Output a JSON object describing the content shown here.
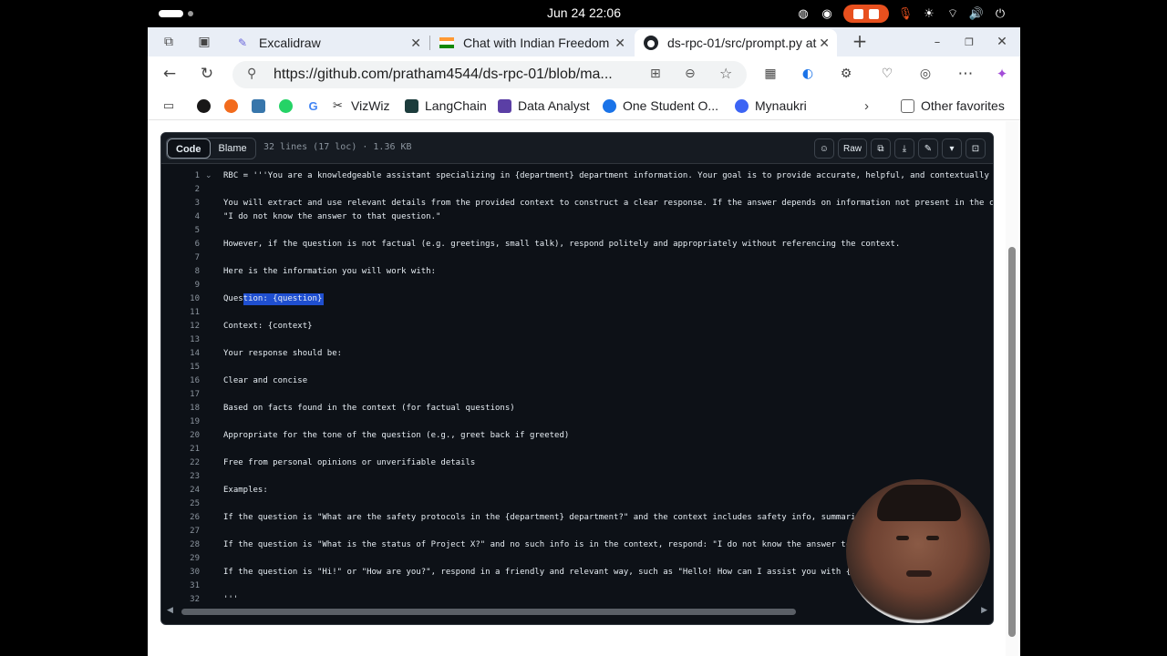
{
  "system": {
    "clock": "Jun 24  22:06"
  },
  "tabs": [
    {
      "label": "Excalidraw",
      "icon": "excalidraw-icon"
    },
    {
      "label": "Chat with Indian Freedom",
      "icon": "india-flag-icon"
    },
    {
      "label": "ds-rpc-01/src/prompt.py at",
      "icon": "github-icon",
      "active": true
    }
  ],
  "nav": {
    "url": "https://github.com/pratham4544/ds-rpc-01/blob/ma..."
  },
  "bookmarks": [
    {
      "label": "",
      "icon": "github-icon",
      "color": "#181717"
    },
    {
      "label": "",
      "icon": "orange-circle-icon",
      "color": "#f26b1d"
    },
    {
      "label": "",
      "icon": "python-icon",
      "color": "#3776ab"
    },
    {
      "label": "",
      "icon": "whatsapp-icon",
      "color": "#25d366"
    },
    {
      "label": "",
      "icon": "google-icon",
      "color": "#4285f4"
    },
    {
      "label": "VizWiz",
      "icon": "vizwiz-icon",
      "color": "#333333"
    },
    {
      "label": "LangChain",
      "icon": "langchain-icon",
      "color": "#1c3c3c"
    },
    {
      "label": "Data Analyst",
      "icon": "data-analyst-icon",
      "color": "#5b3fa5"
    },
    {
      "label": "One Student O...",
      "icon": "one-student-icon",
      "color": "#1a73e8"
    },
    {
      "label": "Mynaukri",
      "icon": "mynaukri-icon",
      "color": "#3c64f4"
    }
  ],
  "bookmarks_other": "Other favorites",
  "code": {
    "tab_code": "Code",
    "tab_blame": "Blame",
    "meta": "32 lines (17 loc) · 1.36 KB",
    "raw_label": "Raw",
    "lines": [
      {
        "n": "1",
        "t": "RBC = '''You are a knowledgeable assistant specializing in {department} department information. Your goal is to provide accurate, helpful, and contextually r"
      },
      {
        "n": "2",
        "t": ""
      },
      {
        "n": "3",
        "t": "You will extract and use relevant details from the provided context to construct a clear response. If the answer depends on information not present in the co"
      },
      {
        "n": "4",
        "t": "\"I do not know the answer to that question.\""
      },
      {
        "n": "5",
        "t": ""
      },
      {
        "n": "6",
        "t": "However, if the question is not factual (e.g. greetings, small talk), respond politely and appropriately without referencing the context."
      },
      {
        "n": "7",
        "t": ""
      },
      {
        "n": "8",
        "t": "Here is the information you will work with:"
      },
      {
        "n": "9",
        "t": ""
      },
      {
        "n": "10",
        "t": "Question: {question}"
      },
      {
        "n": "11",
        "t": ""
      },
      {
        "n": "12",
        "t": "Context: {context}"
      },
      {
        "n": "13",
        "t": ""
      },
      {
        "n": "14",
        "t": "Your response should be:"
      },
      {
        "n": "15",
        "t": ""
      },
      {
        "n": "16",
        "t": "Clear and concise"
      },
      {
        "n": "17",
        "t": ""
      },
      {
        "n": "18",
        "t": "Based on facts found in the context (for factual questions)"
      },
      {
        "n": "19",
        "t": ""
      },
      {
        "n": "20",
        "t": "Appropriate for the tone of the question (e.g., greet back if greeted)"
      },
      {
        "n": "21",
        "t": ""
      },
      {
        "n": "22",
        "t": "Free from personal opinions or unverifiable details"
      },
      {
        "n": "23",
        "t": ""
      },
      {
        "n": "24",
        "t": "Examples:"
      },
      {
        "n": "25",
        "t": ""
      },
      {
        "n": "26",
        "t": "If the question is \"What are the safety protocols in the {department} department?\" and the context includes safety info, summari"
      },
      {
        "n": "27",
        "t": ""
      },
      {
        "n": "28",
        "t": "If the question is \"What is the status of Project X?\" and no such info is in the context, respond: \"I do not know the answer to"
      },
      {
        "n": "29",
        "t": ""
      },
      {
        "n": "30",
        "t": "If the question is \"Hi!\" or \"How are you?\", respond in a friendly and relevant way, such as \"Hello! How can I assist you with {d"
      },
      {
        "n": "31",
        "t": ""
      },
      {
        "n": "32",
        "t": "'''"
      }
    ]
  }
}
